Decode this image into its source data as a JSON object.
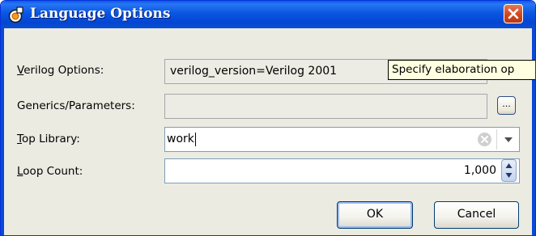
{
  "dialog": {
    "title": "Language Options"
  },
  "rows": {
    "verilog": {
      "mnemonic": "V",
      "rest": "erilog Options:",
      "value": "verilog_version=Verilog 2001"
    },
    "generics": {
      "label": "Generics/Parameters:",
      "value": ""
    },
    "top_library": {
      "mnemonic": "T",
      "rest": "op Library:",
      "value": "work"
    },
    "loop_count": {
      "mnemonic": "L",
      "rest": "oop Count:",
      "value": "1,000"
    }
  },
  "browse_label": "...",
  "tooltip": "Specify elaboration op",
  "buttons": {
    "ok": "OK",
    "cancel": "Cancel"
  },
  "colors": {
    "titlebar": "#0a56e1",
    "dialog_bg": "#ecebe2",
    "close": "#d2461f",
    "tooltip_bg": "#ffffe1"
  },
  "icons": [
    "app-icon",
    "close-icon",
    "clear-icon",
    "dropdown-arrow-icon",
    "spinner-up-icon",
    "spinner-down-icon"
  ]
}
